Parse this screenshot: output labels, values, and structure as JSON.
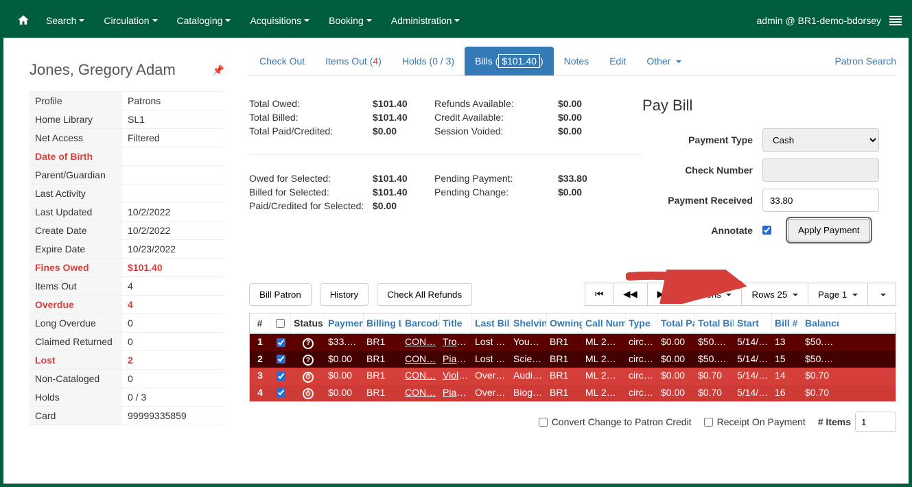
{
  "nav": {
    "search": "Search",
    "circulation": "Circulation",
    "cataloging": "Cataloging",
    "acquisitions": "Acquisitions",
    "booking": "Booking",
    "administration": "Administration",
    "admin_label": "admin @ BR1-demo-bdorsey"
  },
  "patron": {
    "name": "Jones, Gregory Adam",
    "profile_lbl": "Profile",
    "profile": "Patrons",
    "home_lbl": "Home Library",
    "home": "SL1",
    "net_lbl": "Net Access",
    "net": "Filtered",
    "dob_lbl": "Date of Birth",
    "parent_lbl": "Parent/Guardian",
    "last_act_lbl": "Last Activity",
    "last_upd_lbl": "Last Updated",
    "last_upd": "10/2/2022",
    "create_lbl": "Create Date",
    "create": "10/2/2022",
    "expire_lbl": "Expire Date",
    "expire": "10/23/2022",
    "fines_lbl": "Fines Owed",
    "fines": "$101.40",
    "items_lbl": "Items Out",
    "items": "4",
    "overdue_lbl": "Overdue",
    "overdue": "4",
    "long_lbl": "Long Overdue",
    "long": "0",
    "claimed_lbl": "Claimed Returned",
    "claimed": "0",
    "lost_lbl": "Lost",
    "lost": "2",
    "noncat_lbl": "Non-Cataloged",
    "noncat": "0",
    "holds_lbl": "Holds",
    "holds": "0 / 3",
    "card_lbl": "Card",
    "card": "99999335859"
  },
  "tabs": {
    "checkout": "Check Out",
    "itemsout": "Items Out (",
    "itemsout_ct": "4",
    "itemsout_end": ")",
    "holds": "Holds (0 / 3)",
    "bills_pre": "Bills (",
    "bills_amt": "$101.40",
    "bills_end": ")",
    "notes": "Notes",
    "edit": "Edit",
    "other": "Other",
    "patron_search": "Patron Search"
  },
  "totals": {
    "owed_lbl": "Total Owed:",
    "owed": "$101.40",
    "billed_lbl": "Total Billed:",
    "billed": "$101.40",
    "paid_lbl": "Total Paid/Credited:",
    "paid": "$0.00",
    "refunds_lbl": "Refunds Available:",
    "refunds": "$0.00",
    "credit_lbl": "Credit Available:",
    "credit": "$0.00",
    "voided_lbl": "Session Voided:",
    "voided": "$0.00",
    "sel_owed_lbl": "Owed for Selected:",
    "sel_owed": "$101.40",
    "sel_billed_lbl": "Billed for Selected:",
    "sel_billed": "$101.40",
    "sel_paid_lbl": "Paid/Credited for Selected:",
    "sel_paid": "$0.00",
    "pending_pay_lbl": "Pending Payment:",
    "pending_pay": "$33.80",
    "pending_chg_lbl": "Pending Change:",
    "pending_chg": "$0.00"
  },
  "paybill": {
    "title": "Pay Bill",
    "type_lbl": "Payment Type",
    "type": "Cash",
    "check_lbl": "Check Number",
    "recv_lbl": "Payment Received",
    "recv": "33.80",
    "annotate_lbl": "Annotate",
    "apply": "Apply Payment"
  },
  "actions": {
    "bill_patron": "Bill Patron",
    "history": "History",
    "check_refunds": "Check All Refunds",
    "actions": "Actions",
    "rows": "Rows 25",
    "page": "Page 1"
  },
  "grid": {
    "h_num": "#",
    "h_status": "Status",
    "h_pay": "Payment",
    "h_loc": "Billing L",
    "h_bar": "Barcode",
    "h_title": "Title",
    "h_last": "Last Bill",
    "h_shelf": "Shelving",
    "h_own": "Owning",
    "h_call": "Call Num",
    "h_type": "Type",
    "h_tp": "Total Pa",
    "h_tb": "Total Bil",
    "h_start": "Start",
    "h_bill": "Bill #",
    "h_bal": "Balance",
    "rows": [
      {
        "n": "1",
        "status": "?",
        "pay": "$33.8…",
        "loc": "BR1",
        "bar": "CON…",
        "title": "Trom…",
        "last": "Lost …",
        "shelf": "Youn…",
        "own": "BR1",
        "call": "ML 2…",
        "type": "circul…",
        "tp": "$0.00",
        "tb": "$50.0…",
        "start": "5/14/…",
        "bill": "13",
        "bal": "$50.0…"
      },
      {
        "n": "2",
        "status": "?",
        "pay": "$0.00",
        "loc": "BR1",
        "bar": "CON…",
        "title": "Piano…",
        "last": "Lost …",
        "shelf": "Scien…",
        "own": "BR1",
        "call": "ML 2…",
        "type": "circul…",
        "tp": "$0.00",
        "tb": "$50.0…",
        "start": "5/14/…",
        "bill": "15",
        "bal": "$50.0…"
      },
      {
        "n": "3",
        "status": "⏱",
        "pay": "$0.00",
        "loc": "BR1",
        "bar": "CON…",
        "title": "Violin…",
        "last": "Over…",
        "shelf": "Audio…",
        "own": "BR1",
        "call": "ML 2…",
        "type": "circul…",
        "tp": "$0.00",
        "tb": "$0.70",
        "start": "5/14/…",
        "bill": "14",
        "bal": "$0.70"
      },
      {
        "n": "4",
        "status": "⏱",
        "pay": "$0.00",
        "loc": "BR1",
        "bar": "CON…",
        "title": "Piano…",
        "last": "Over…",
        "shelf": "Biogr…",
        "own": "BR1",
        "call": "ML 2…",
        "type": "circul…",
        "tp": "$0.00",
        "tb": "$0.70",
        "start": "5/14/…",
        "bill": "16",
        "bal": "$0.70"
      }
    ]
  },
  "footer": {
    "convert": "Convert Change to Patron Credit",
    "receipt": "Receipt On Payment",
    "items_lbl": "# Items",
    "items_val": "1"
  }
}
